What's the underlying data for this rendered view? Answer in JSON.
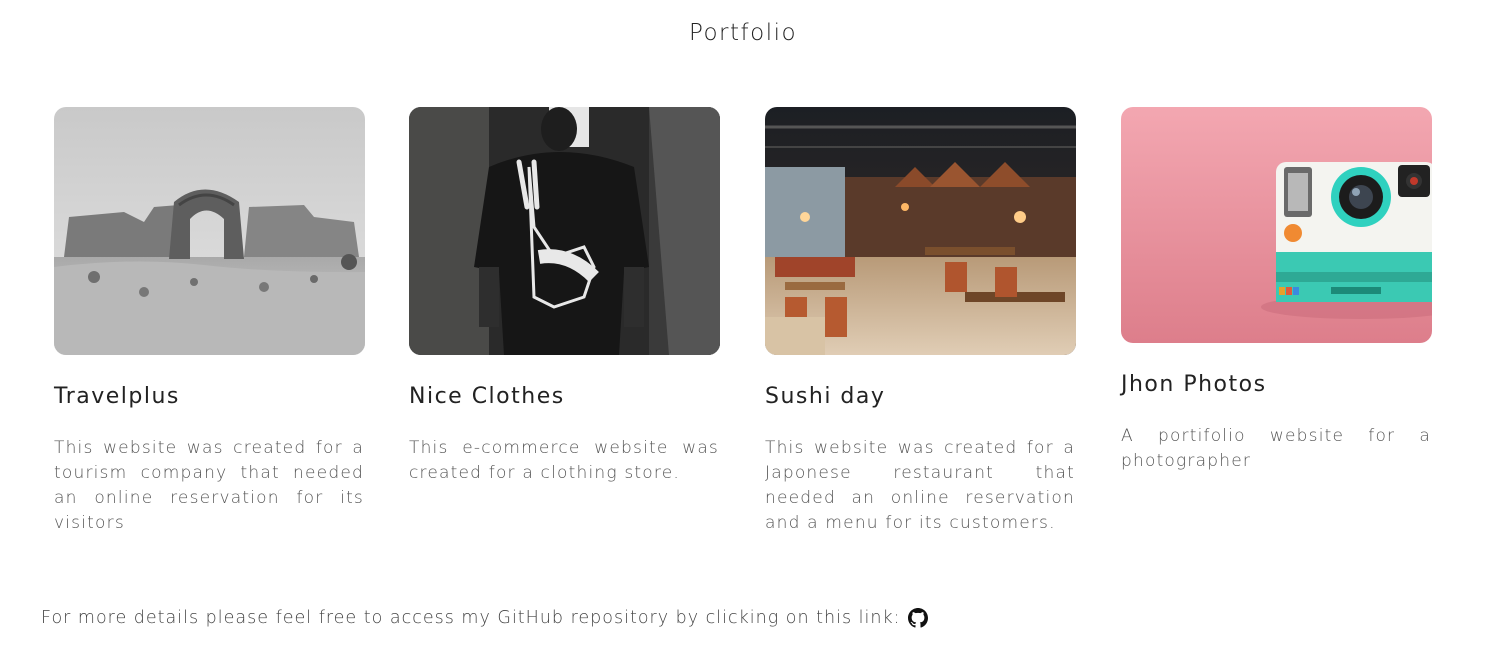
{
  "page_title": "Portfolio",
  "projects": [
    {
      "title": "Travelplus",
      "description": "This website was created for a tourism company that needed an online reservation for its visitors",
      "image_icon": "ancient-ruins-image"
    },
    {
      "title": "Nice Clothes",
      "description": "This e-commerce website was created for a clothing store.",
      "image_icon": "tshirt-back-image"
    },
    {
      "title": "Sushi day",
      "description": "This website was created for a Japonese restaurant that needed an online reservation and a menu for its customers.",
      "image_icon": "restaurant-interior-image"
    },
    {
      "title": "Jhon Photos",
      "description": "A portifolio website for a photographer",
      "image_icon": "instant-camera-image"
    }
  ],
  "footer": {
    "text": "For more details please feel free to access my GitHub repository by clicking on this link:",
    "link_icon": "github-icon"
  }
}
